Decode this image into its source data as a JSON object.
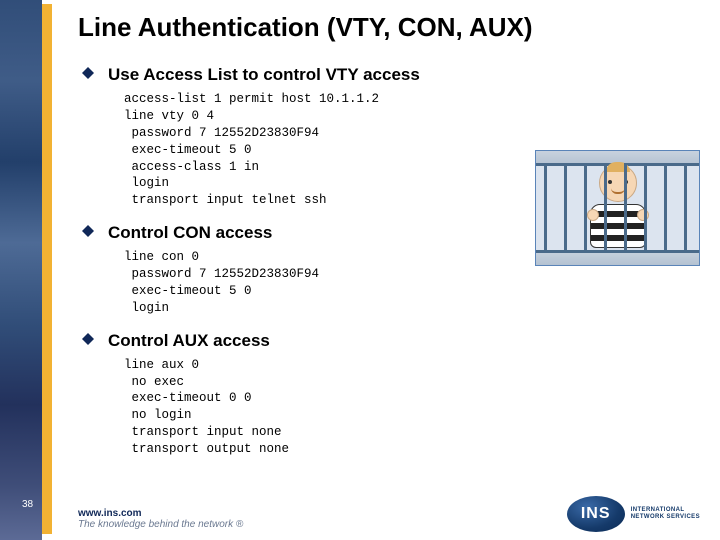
{
  "slide": {
    "number": "38",
    "title": "Line Authentication (VTY, CON, AUX)"
  },
  "bullets": [
    {
      "heading": "Use Access List to control VTY access",
      "code": "access-list 1 permit host 10.1.1.2\nline vty 0 4\n password 7 12552D23830F94\n exec-timeout 5 0\n access-class 1 in\n login\n transport input telnet ssh"
    },
    {
      "heading": "Control CON access",
      "code": "line con 0\n password 7 12552D23830F94\n exec-timeout 5 0\n login"
    },
    {
      "heading": "Control AUX access",
      "code": "line aux 0\n no exec\n exec-timeout 0 0\n no login\n transport input none\n transport output none"
    }
  ],
  "footer": {
    "url": "www.ins.com",
    "tagline": "The knowledge behind the network ®"
  },
  "logo": {
    "abbr": "INS",
    "line1": "INTERNATIONAL",
    "line2": "NETWORK SERVICES"
  },
  "cartoon_alt": "prisoner-behind-bars-illustration"
}
